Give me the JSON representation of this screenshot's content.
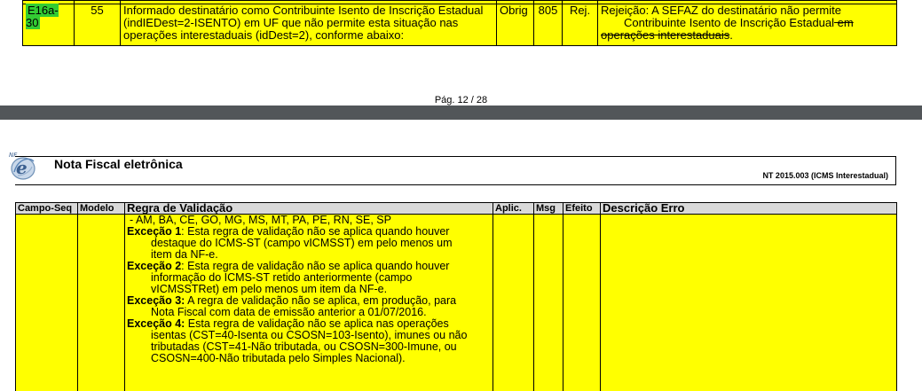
{
  "top_row": {
    "campo": "E16a-30",
    "modelo": "55",
    "regra": "Informado destinatário como Contribuinte Isento de Inscrição Estadual (indIEDest=2-ISENTO) em UF que não permite esta situação nas operações interestaduais (idDest=2), conforme abaixo:",
    "aplic": "Obrig",
    "msg": "805",
    "efeito": "Rej.",
    "descricao_first": "Rejeição: A SEFAZ do destinatário não permite",
    "descricao_second": "Contribuinte Isento de Inscrição Estadual",
    "descricao_struck": " em operações interestaduais",
    "descricao_end": "."
  },
  "page_number": "Pág. 12 / 28",
  "header": {
    "title": "Nota Fiscal eletrônica",
    "subtitle": "NT 2015.003 (ICMS Interestadual)"
  },
  "table": {
    "columns": {
      "campo_seq": "Campo-Seq",
      "modelo": "Modelo",
      "regra": "Regra de Validação",
      "aplic": "Aplic.",
      "msg": "Msg",
      "efeito": "Efeito",
      "descricao": "Descrição Erro"
    },
    "rule": {
      "ufs": "- AM, BA, CE, GO, MG, MS, MT, PA, PE, RN, SE, SP",
      "exc1_title": "Exceção 1",
      "exc1_text_a": ": Esta regra de validação não se aplica quando houver",
      "exc1_text_b": "destaque do ICMS-ST (campo vICMSST) em pelo menos um",
      "exc1_text_c": "item da NF-e.",
      "exc2_title": "Exceção 2",
      "exc2_text_a": ": Esta regra de validação não se aplica quando houver",
      "exc2_text_b": "informação do ICMS-ST retido anteriormente (campo",
      "exc2_text_c": "vICMSSTRet) em pelo menos um item da NF-e.",
      "exc3_title": "Exceção 3:",
      "exc3_text_a": " A regra de validação não se aplica, em produção, para",
      "exc3_text_b": "Nota Fiscal com data de emissão anterior a 01/07/2016.",
      "exc4_title": "Exceção 4:",
      "exc4_text_a": " Esta regra de validação não se aplica nas operações",
      "exc4_text_b": "isentas (CST=40-Isenta ou CSOSN=103-Isento), imunes ou não",
      "exc4_text_c": "tributadas (CST=41-Não tributada, ou CSOSN=300-Imune, ou",
      "exc4_text_d": "CSOSN=400-Não tributada pelo Simples Nacional)."
    }
  },
  "colors": {
    "highlight_yellow": "#ffff00",
    "highlight_green": "#33cc33",
    "header_gray": "#d9d9d9",
    "viewer_gap": "#525659"
  }
}
